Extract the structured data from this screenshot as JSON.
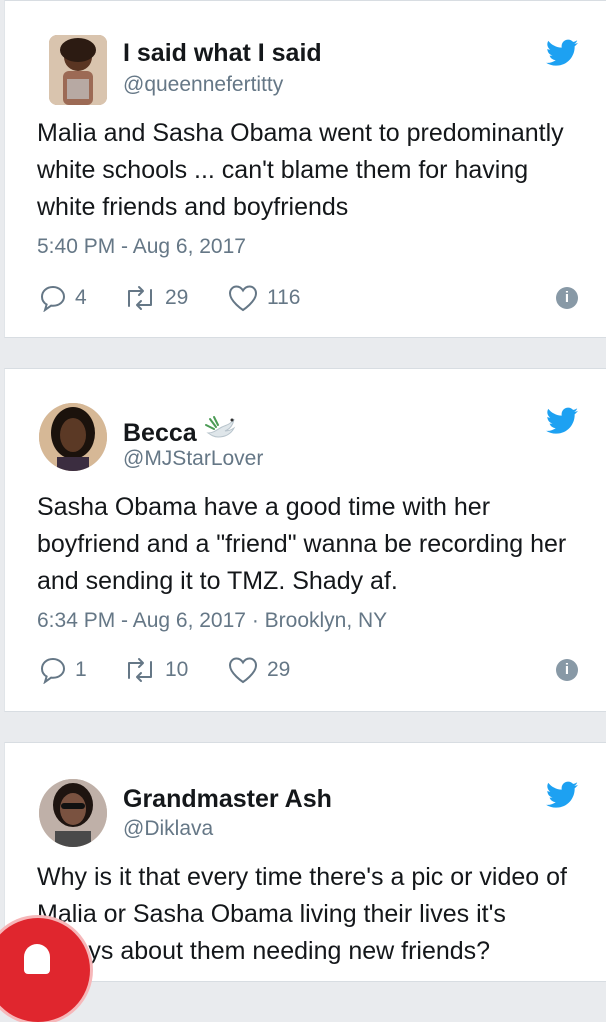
{
  "tweets": [
    {
      "name": "I said what I said",
      "handle": "@queennefertitty",
      "text": "Malia and Sasha Obama went to predominantly white schools ... can't blame them for having white friends and boyfriends",
      "timestamp": "5:40 PM - Aug 6, 2017",
      "location": "",
      "replies": "4",
      "retweets": "29",
      "likes": "116",
      "name_emoji": ""
    },
    {
      "name": "Becca",
      "handle": "@MJStarLover",
      "text": "Sasha Obama have a good time with her boyfriend and a \"friend\" wanna be recording her and sending it to TMZ. Shady af.",
      "timestamp": "6:34 PM - Aug 6, 2017",
      "location": " · Brooklyn, NY",
      "replies": "1",
      "retweets": "10",
      "likes": "29",
      "name_emoji": "dove-icon"
    },
    {
      "name": "Grandmaster Ash",
      "handle": "@Diklava",
      "text": "Why is it that every time there's a pic or video of Malia or Sasha Obama living their lives it's always about them needing new friends?",
      "timestamp": "",
      "location": "",
      "replies": "",
      "retweets": "",
      "likes": "",
      "name_emoji": ""
    }
  ],
  "colors": {
    "background": "#e9ebee",
    "card": "#ffffff",
    "twitter_blue": "#1da1f2",
    "muted": "#657786",
    "text": "#14171a",
    "fab": "#e0262e"
  },
  "icons": [
    "twitter-bird-icon",
    "reply-icon",
    "retweet-icon",
    "like-icon",
    "info-icon",
    "dove-icon"
  ]
}
